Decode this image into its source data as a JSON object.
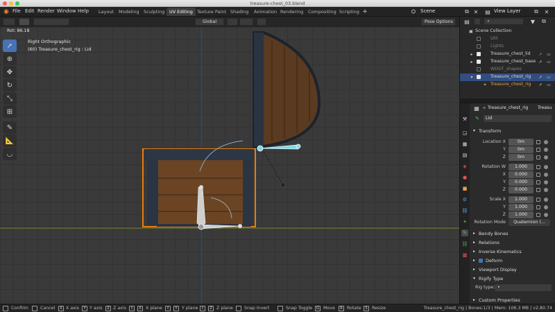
{
  "window": {
    "title": "treasure-chest_03.blend"
  },
  "menu": [
    "File",
    "Edit",
    "Render",
    "Window",
    "Help"
  ],
  "workspaces": [
    "Layout",
    "Modeling",
    "Sculpting",
    "UV Editing",
    "Texture Paint",
    "Shading",
    "Animation",
    "Rendering",
    "Compositing",
    "Scripting"
  ],
  "active_workspace": "UV Editing",
  "scene": {
    "name": "Scene",
    "view_layer": "View Layer"
  },
  "viewport": {
    "rot_label": "Rot: 86.18",
    "view_name": "Right Orthographic",
    "object_info": "(60) Treasure_chest_rig : Lid",
    "orientation": "Global",
    "pose_options": "Pose Options"
  },
  "outliner": {
    "root": "Scene Collection",
    "items": [
      {
        "name": "Util",
        "checked": false
      },
      {
        "name": "Lights",
        "checked": false
      },
      {
        "name": "Treasure_chest_lid",
        "checked": true
      },
      {
        "name": "Treasure_chest_base",
        "checked": true
      },
      {
        "name": "WDGT_shapes",
        "checked": false
      },
      {
        "name": "Treasure_chest_rig",
        "checked": true,
        "selected": true
      },
      {
        "name": "Treasure_chest_rig",
        "child": true
      }
    ]
  },
  "properties": {
    "breadcrumb_object": "Treasure_chest_rig",
    "breadcrumb_overflow": "Treasu",
    "bone_name": "Lid",
    "transform_title": "Transform",
    "location": {
      "label": "Location X",
      "x": "0m",
      "y": "0m",
      "z": "0m"
    },
    "rotation": {
      "label": "Rotation W",
      "w": "1.000",
      "x": "0.000",
      "y": "0.000",
      "z": "0.000"
    },
    "scale": {
      "label": "Scale X",
      "x": "1.000",
      "y": "1.000",
      "z": "1.000"
    },
    "axis_labels": {
      "x": "X",
      "y": "Y",
      "z": "Z"
    },
    "rotation_mode_label": "Rotation Mode",
    "rotation_mode_value": "Quaternion (...",
    "panels": [
      "Bendy Bones",
      "Relations",
      "Inverse Kinematics",
      "Deform",
      "Viewport Display",
      "Rigify Type"
    ],
    "rig_type_label": "Rig type:",
    "rig_type_value": "•",
    "custom_properties": "Custom Properties"
  },
  "statusbar": {
    "items": [
      {
        "key": "",
        "label": "Confirm"
      },
      {
        "key": "",
        "label": "Cancel"
      },
      {
        "key": "X",
        "label": "X axis"
      },
      {
        "key": "Y",
        "label": "Y axis"
      },
      {
        "key": "Z",
        "label": "Z axis"
      },
      {
        "key": "X",
        "label": "X plane"
      },
      {
        "key": "Y",
        "label": "Y plane"
      },
      {
        "key": "Z",
        "label": "Z plane"
      },
      {
        "key": "",
        "label": "Snap Invert"
      },
      {
        "key": "",
        "label": "Snap Toggle"
      },
      {
        "key": "G",
        "label": "Move"
      },
      {
        "key": "R",
        "label": "Rotate"
      },
      {
        "key": "S",
        "label": "Resize"
      }
    ],
    "right_text": "Treasure_chest_rig | Bones:1/3 | Mem: 106.3 MB | v2.80.74"
  },
  "colors": {
    "accent": "#4772b3",
    "bone_select": "#7fd9e6",
    "outline": "#e87d0d"
  }
}
